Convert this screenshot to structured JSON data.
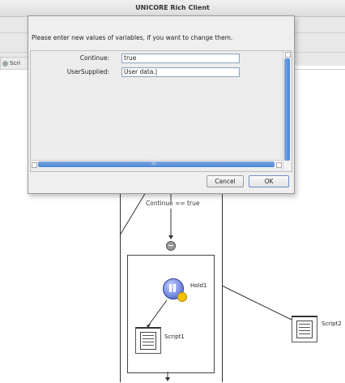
{
  "window": {
    "title": "UNICORE Rich Client"
  },
  "view_tab": {
    "label": "Scri"
  },
  "dialog": {
    "message": "Please enter new values of variables, if you want to change them.",
    "variables": [
      {
        "label": "Continue:",
        "value": "true"
      },
      {
        "label": "UserSupplied:",
        "value": "User data.|"
      }
    ],
    "scroll_grip": "|||",
    "cancel_label": "Cancel",
    "ok_label": "OK"
  },
  "workflow": {
    "condition": "Continue == true",
    "hold_node": "Hold1",
    "script1": "Script1",
    "script2": "Script2"
  }
}
